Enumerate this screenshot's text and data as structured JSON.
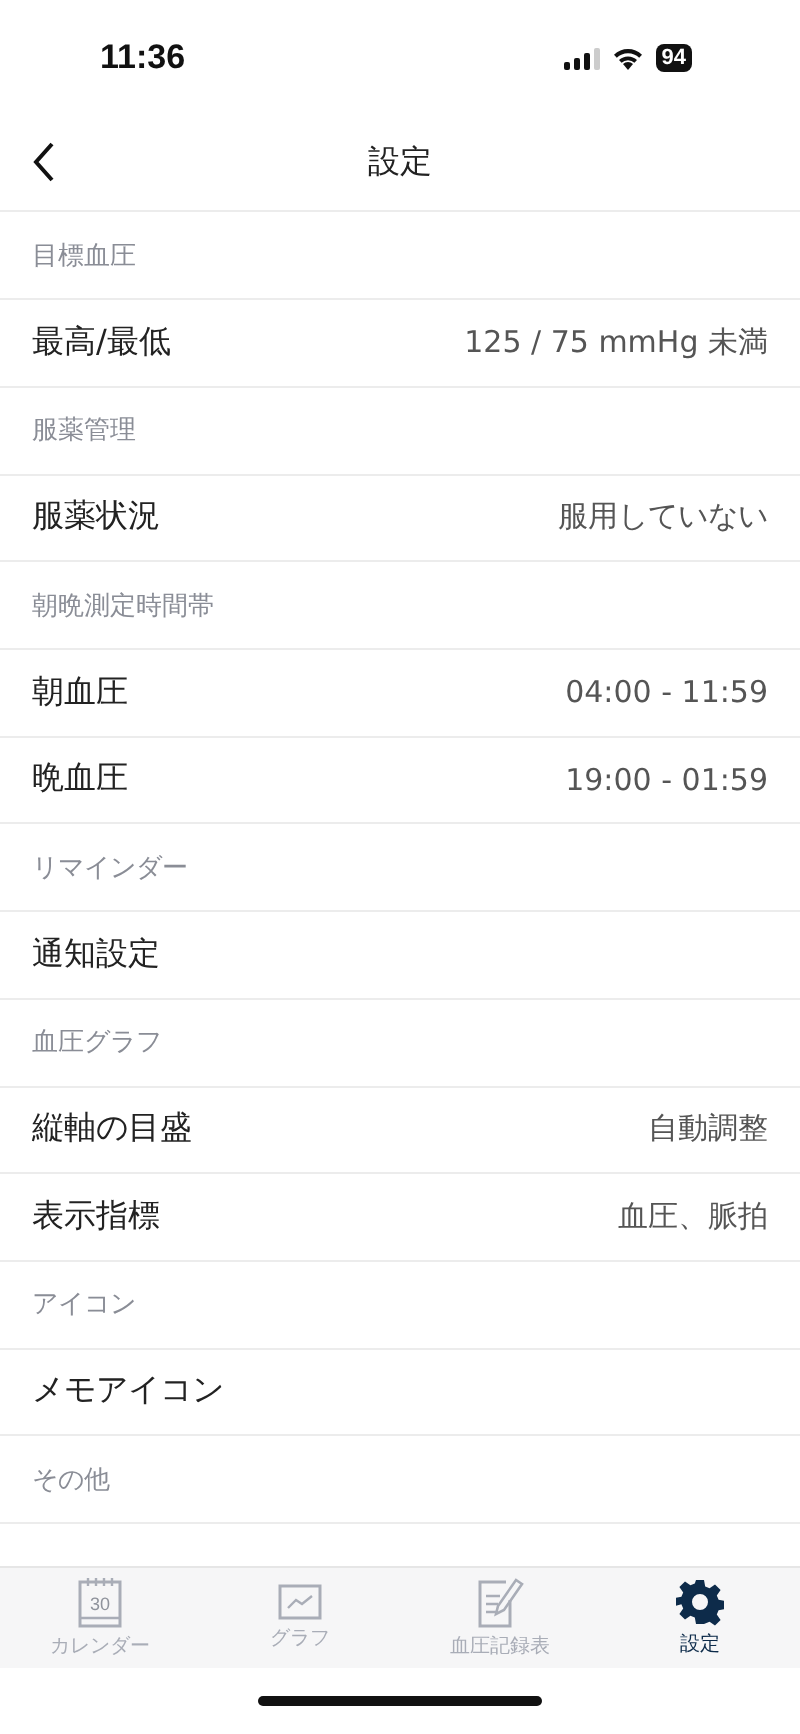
{
  "status_bar": {
    "time": "11:36",
    "battery": "94"
  },
  "nav": {
    "title": "設定"
  },
  "sections": [
    {
      "header": "目標血圧",
      "rows": [
        {
          "label": "最高/最低",
          "value": "125 / 75 mmHg 未満"
        }
      ]
    },
    {
      "header": "服薬管理",
      "rows": [
        {
          "label": "服薬状況",
          "value": "服用していない"
        }
      ]
    },
    {
      "header": "朝晩測定時間帯",
      "rows": [
        {
          "label": "朝血圧",
          "value": "04:00 - 11:59"
        },
        {
          "label": "晩血圧",
          "value": "19:00 - 01:59"
        }
      ]
    },
    {
      "header": "リマインダー",
      "rows": [
        {
          "label": "通知設定"
        }
      ]
    },
    {
      "header": "血圧グラフ",
      "rows": [
        {
          "label": "縦軸の目盛",
          "value": "自動調整"
        },
        {
          "label": "表示指標",
          "value": "血圧、脈拍"
        }
      ]
    },
    {
      "header": "アイコン",
      "rows": [
        {
          "label": "メモアイコン"
        }
      ]
    },
    {
      "header": "その他"
    }
  ],
  "tabs": [
    {
      "kind": "calendar",
      "label": "カレンダー",
      "icon_text": "30",
      "selected": false
    },
    {
      "kind": "graph",
      "label": "グラフ",
      "selected": false
    },
    {
      "kind": "record",
      "label": "血圧記録表",
      "selected": false
    },
    {
      "kind": "settings",
      "label": "設定",
      "selected": true
    }
  ]
}
